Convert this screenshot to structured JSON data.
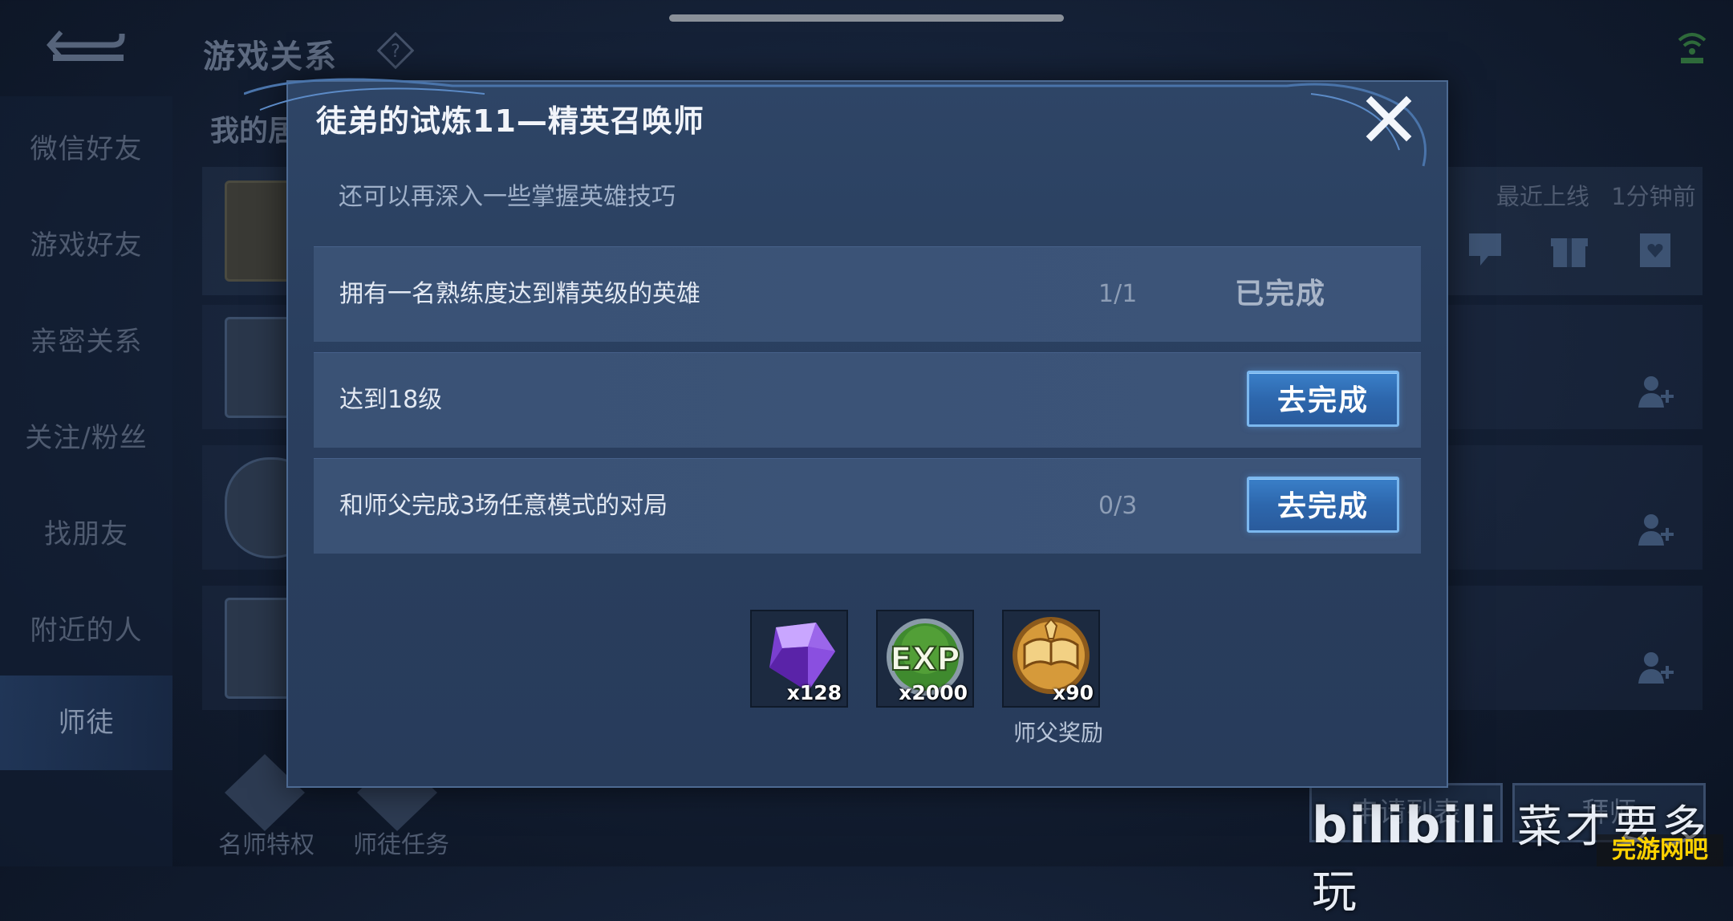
{
  "background": {
    "top_title": "游戏关系",
    "subtab": "我的居",
    "sidebar_items": [
      "微信好友",
      "游戏好友",
      "亲密关系",
      "关注/粉丝",
      "找朋友",
      "附近的人",
      "师徒"
    ],
    "recent_online_label": "最近上线",
    "recent_online_time": "1分钟前",
    "bottom_items": [
      "名师特权",
      "师徒任务"
    ],
    "bottom_buttons": [
      "申请列表",
      "拜师"
    ],
    "watermark_main": "bilibili",
    "watermark_sub": "菜才要多玩",
    "watermark_tag": "完游网吧"
  },
  "dialog": {
    "title": "徒弟的试炼11—精英召唤师",
    "description": "还可以再深入一些掌握英雄技巧",
    "tasks": [
      {
        "text": "拥有一名熟练度达到精英级的英雄",
        "progress": "1/1",
        "status": "已完成"
      },
      {
        "text": "达到18级",
        "progress": "",
        "action": "去完成"
      },
      {
        "text": "和师父完成3场任意模式的对局",
        "progress": "0/3",
        "action": "去完成"
      }
    ],
    "rewards": [
      {
        "icon": "purple-gem-icon",
        "count": "x128"
      },
      {
        "icon": "exp-icon",
        "count": "x2000"
      },
      {
        "icon": "master-book-icon",
        "count": "x90"
      }
    ],
    "reward_label": "师父奖励"
  },
  "colors": {
    "accent_button": "#2d67ad",
    "button_border": "#7bb7ee",
    "dialog_bg": "#2a3f5f"
  }
}
